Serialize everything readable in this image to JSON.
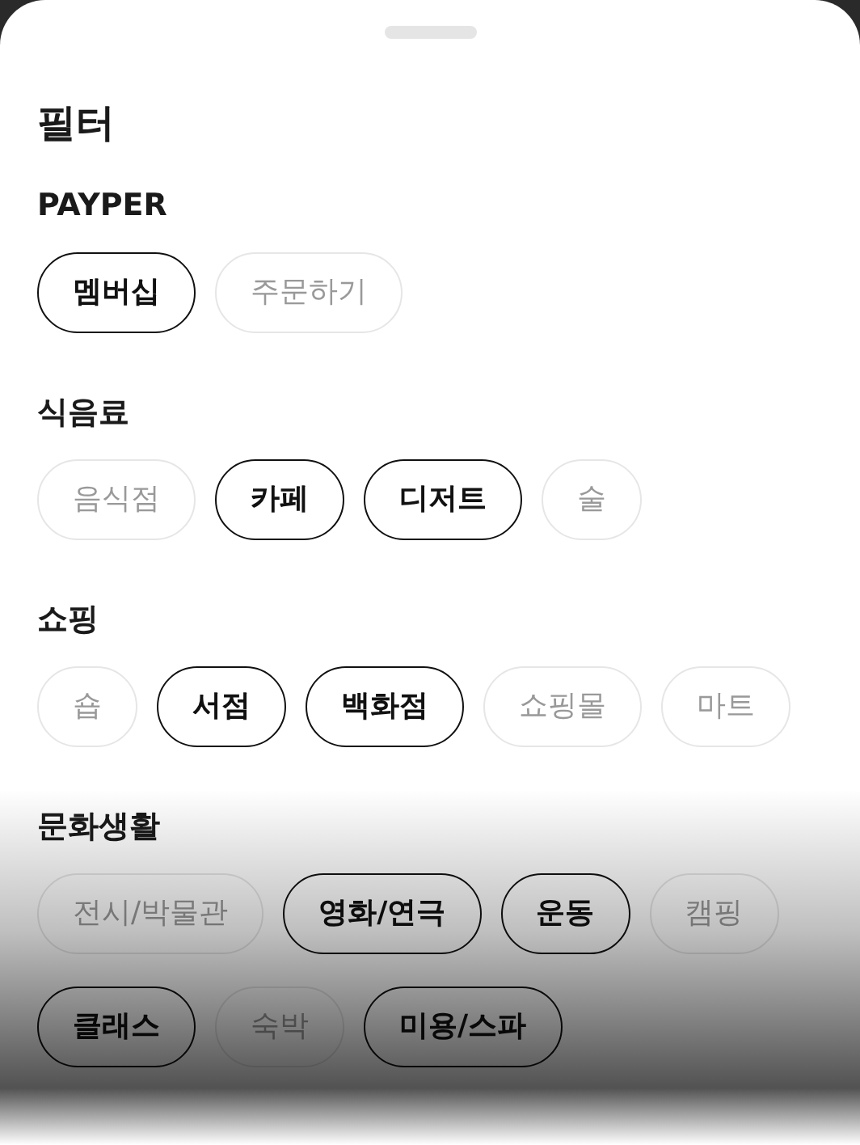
{
  "title": "필터",
  "sections": [
    {
      "label": "PAYPER",
      "chips": [
        {
          "label": "멤버십",
          "selected": true
        },
        {
          "label": "주문하기",
          "selected": false
        }
      ]
    },
    {
      "label": "식음료",
      "chips": [
        {
          "label": "음식점",
          "selected": false
        },
        {
          "label": "카페",
          "selected": true
        },
        {
          "label": "디저트",
          "selected": true
        },
        {
          "label": "술",
          "selected": false
        }
      ]
    },
    {
      "label": "쇼핑",
      "chips": [
        {
          "label": "숍",
          "selected": false
        },
        {
          "label": "서점",
          "selected": true
        },
        {
          "label": "백화점",
          "selected": true
        },
        {
          "label": "쇼핑몰",
          "selected": false
        },
        {
          "label": "마트",
          "selected": false
        }
      ]
    },
    {
      "label": "문화생활",
      "chips": [
        {
          "label": "전시/박물관",
          "selected": false
        },
        {
          "label": "영화/연극",
          "selected": true
        },
        {
          "label": "운동",
          "selected": true
        },
        {
          "label": "캠핑",
          "selected": false
        },
        {
          "label": "클래스",
          "selected": true
        },
        {
          "label": "숙박",
          "selected": false
        },
        {
          "label": "미용/스파",
          "selected": true
        }
      ]
    }
  ]
}
